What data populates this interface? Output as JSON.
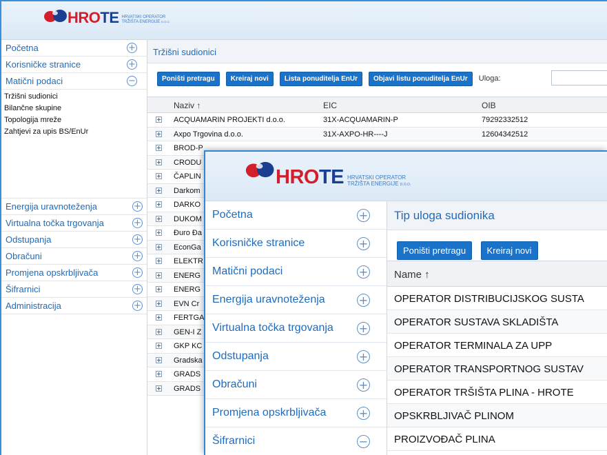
{
  "brand": {
    "name_red": "HRO",
    "name_blue": "TE",
    "tagline_1": "HRVATSKI OPERATOR",
    "tagline_2": "TRŽIŠTA ENERGIJE",
    "tagline_suffix": "d.o.o."
  },
  "back": {
    "sidebar": {
      "top_items": [
        {
          "label": "Početna",
          "state": "collapsed"
        },
        {
          "label": "Korisničke stranice",
          "state": "collapsed"
        },
        {
          "label": "Matični podaci",
          "state": "expanded"
        }
      ],
      "sub_items": [
        "Tržišni sudionici",
        "Bilančne skupine",
        "Topologija mreže",
        "Zahtjevi za upis BS/EnUr"
      ],
      "bottom_items": [
        {
          "label": "Energija uravnoteženja"
        },
        {
          "label": "Virtualna točka trgovanja"
        },
        {
          "label": "Odstupanja"
        },
        {
          "label": "Obračuni"
        },
        {
          "label": "Promjena opskrbljivača"
        },
        {
          "label": "Šifrarnici"
        },
        {
          "label": "Administracija"
        }
      ]
    },
    "title": "Tržišni sudionici",
    "toolbar": {
      "reset": "Poništi pretragu",
      "create": "Kreiraj novi",
      "list_bidders": "Lista ponuditelja EnUr",
      "publish_list": "Objavi listu ponuditelja EnUr",
      "role_label": "Uloga:"
    },
    "columns": {
      "name": "Naziv ↑",
      "eic": "EIC",
      "oib": "OIB"
    },
    "rows": [
      {
        "name": "ACQUAMARIN PROJEKTI d.o.o.",
        "eic": "31X-ACQUAMARIN-P",
        "oib": "79292332512"
      },
      {
        "name": "Axpo Trgovina d.o.o.",
        "eic": "31X-AXPO-HR----J",
        "oib": "12604342512"
      },
      {
        "name": "BROD-P",
        "eic": "",
        "oib": ""
      },
      {
        "name": "CRODU",
        "eic": "",
        "oib": ""
      },
      {
        "name": "ČAPLIN",
        "eic": "",
        "oib": ""
      },
      {
        "name": "Darkom",
        "eic": "",
        "oib": ""
      },
      {
        "name": "DARKO",
        "eic": "",
        "oib": ""
      },
      {
        "name": "DUKOM",
        "eic": "",
        "oib": ""
      },
      {
        "name": "Đuro Đa",
        "eic": "",
        "oib": ""
      },
      {
        "name": "EconGa",
        "eic": "",
        "oib": ""
      },
      {
        "name": "ELEKTR",
        "eic": "",
        "oib": ""
      },
      {
        "name": "ENERG",
        "eic": "",
        "oib": ""
      },
      {
        "name": "ENERG",
        "eic": "",
        "oib": ""
      },
      {
        "name": "EVN Cr",
        "eic": "",
        "oib": ""
      },
      {
        "name": "FERTGA",
        "eic": "",
        "oib": ""
      },
      {
        "name": "GEN-I Z",
        "eic": "",
        "oib": ""
      },
      {
        "name": "GKP KC",
        "eic": "",
        "oib": ""
      },
      {
        "name": "Gradska",
        "eic": "",
        "oib": ""
      },
      {
        "name": "GRADS",
        "eic": "",
        "oib": ""
      },
      {
        "name": "GRADS",
        "eic": "",
        "oib": ""
      }
    ]
  },
  "front": {
    "sidebar": [
      {
        "label": "Početna",
        "state": "collapsed"
      },
      {
        "label": "Korisničke stranice",
        "state": "collapsed"
      },
      {
        "label": "Matični podaci",
        "state": "collapsed"
      },
      {
        "label": "Energija uravnoteženja",
        "state": "collapsed"
      },
      {
        "label": "Virtualna točka trgovanja",
        "state": "collapsed"
      },
      {
        "label": "Odstupanja",
        "state": "collapsed"
      },
      {
        "label": "Obračuni",
        "state": "collapsed"
      },
      {
        "label": "Promjena opskrbljivača",
        "state": "collapsed"
      },
      {
        "label": "Šifrarnici",
        "state": "expanded"
      }
    ],
    "title": "Tip uloga sudionika",
    "toolbar": {
      "reset": "Poništi pretragu",
      "create": "Kreiraj novi"
    },
    "column": "Name ↑",
    "rows": [
      "OPERATOR DISTRIBUCIJSKOG SUSTA",
      "OPERATOR SUSTAVA SKLADIŠTA",
      "OPERATOR TERMINALA ZA UPP",
      "OPERATOR TRANSPORTNOG SUSTAV",
      "OPERATOR TRŠIŠTA PLINA - HROTE",
      "OPSKRBLJIVAČ PLINOM",
      "PROIZVOĐAČ PLINA"
    ]
  },
  "colors": {
    "accent": "#1a73c9",
    "link": "#1e6bbd",
    "brand_red": "#d21f2b",
    "brand_blue": "#1b3f8f"
  },
  "icons": {
    "collapsed": "plus-circle-icon",
    "expanded": "minus-circle-icon",
    "row_expand": "plus-square-icon"
  }
}
